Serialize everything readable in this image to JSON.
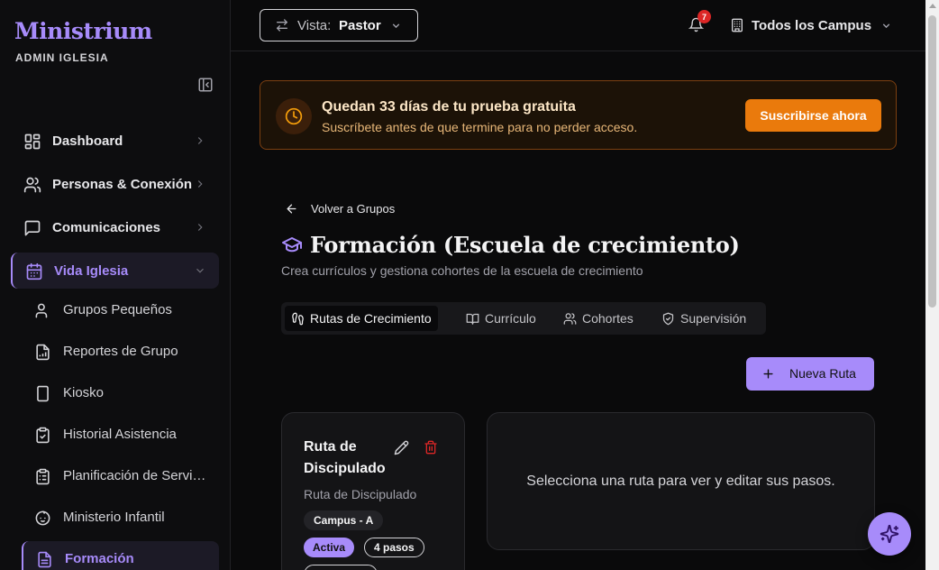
{
  "sidebar": {
    "brand": "Ministrium",
    "brand_sub": "ADMIN IGLESIA",
    "nav": [
      {
        "label": "Dashboard",
        "icon": "dashboard-icon"
      },
      {
        "label": "Personas & Conexión",
        "icon": "users-icon"
      },
      {
        "label": "Comunicaciones",
        "icon": "message-icon"
      },
      {
        "label": "Vida Iglesia",
        "icon": "calendar-icon",
        "expanded": true
      }
    ],
    "sub_items": [
      {
        "label": "Grupos Pequeños",
        "icon": "user-group-icon"
      },
      {
        "label": "Reportes de Grupo",
        "icon": "report-icon"
      },
      {
        "label": "Kiosko",
        "icon": "tablet-icon"
      },
      {
        "label": "Historial Asistencia",
        "icon": "clipboard-check-icon"
      },
      {
        "label": "Planificación de Servicios",
        "icon": "clipboard-list-icon"
      },
      {
        "label": "Ministerio Infantil",
        "icon": "baby-icon"
      },
      {
        "label": "Formación",
        "icon": "book-icon",
        "active": true
      }
    ]
  },
  "header": {
    "vista_label": "Vista:",
    "vista_value": "Pastor",
    "notifications_count": "7",
    "campus_label": "Todos los Campus"
  },
  "trial": {
    "title": "Quedan 33 días de tu prueba gratuita",
    "subtitle": "Suscríbete antes de que termine para no perder acceso.",
    "cta": "Suscribirse ahora"
  },
  "page": {
    "back_label": "Volver a Grupos",
    "title": "Formación (Escuela de crecimiento)",
    "subtitle": "Crea currículos y gestiona cohortes de la escuela de crecimiento",
    "tabs": [
      {
        "label": "Rutas de Crecimiento",
        "icon": "footprints-icon",
        "active": true
      },
      {
        "label": "Currículo",
        "icon": "book-open-icon"
      },
      {
        "label": "Cohortes",
        "icon": "users-icon"
      },
      {
        "label": "Supervisión",
        "icon": "shield-check-icon"
      }
    ],
    "new_route_label": "Nueva Ruta"
  },
  "route": {
    "title": "Ruta de Discipulado",
    "subtitle": "Ruta de Discipulado",
    "campus": "Campus - A",
    "status": "Activa",
    "steps": "4 pasos"
  },
  "empty_panel": {
    "message": "Selecciona una ruta para ver y editar sus pasos."
  },
  "colors": {
    "accent": "#a78bfa",
    "trial_cta": "#ea7a0c",
    "danger": "#dc2626",
    "background": "#0a0a0b"
  }
}
